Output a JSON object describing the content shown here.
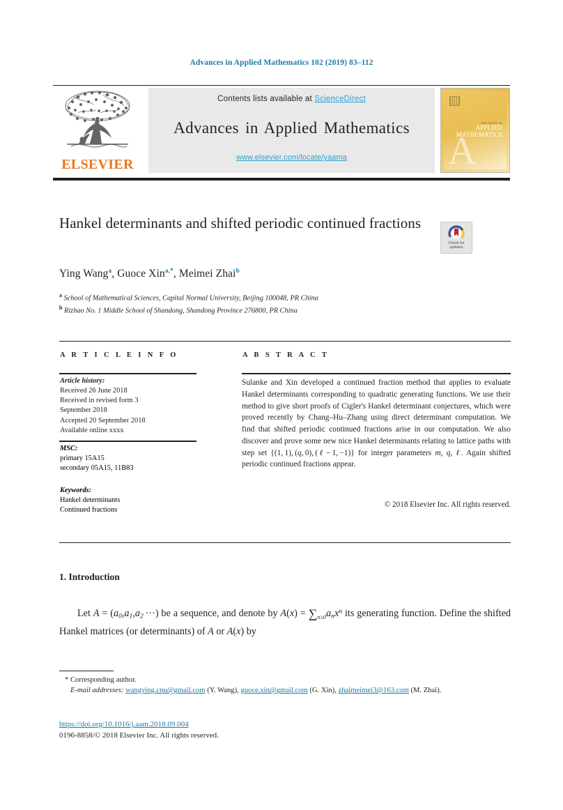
{
  "running_head": "Advances in Applied Mathematics 102 (2019) 83–112",
  "masthead": {
    "contents_prefix": "Contents lists available at ",
    "sciencedirect": "ScienceDirect",
    "journal_title": "Advances in Applied Mathematics",
    "journal_url": "www.elsevier.com/locate/yaama",
    "publisher_wordmark": "ELSEVIER",
    "cover": {
      "line_small": "ADVANCES IN",
      "line_1": "APPLIED",
      "line_2": "MATHEMATICS",
      "big_letter": "A"
    },
    "colors": {
      "link": "#2d9fd0",
      "rule": "#231f20",
      "box_bg": "#e9e9e9",
      "elsevier_orange": "#e87722",
      "cover_gold": "#eec664"
    }
  },
  "article": {
    "title": "Hankel determinants and shifted periodic continued fractions",
    "crossmark": {
      "line1": "Check for",
      "line2": "updates"
    },
    "authors_html": "Ying Wang<sup class=\"aff-mark\">a</sup>, Guoce Xin<sup class=\"aff-mark\">a,*</sup>, Meimei Zhai<sup class=\"aff-mark\">b</sup>",
    "affiliation_a": "School of Mathematical Sciences, Capital Normal University, Beijing 100048, PR China",
    "affiliation_b": "Rizhao No. 1 Middle School of Shandong, Shandong Province 276800, PR China"
  },
  "info_column": {
    "heading": "A R T I C L E   I N F O",
    "history_label": "Article history:",
    "history_lines": [
      "Received 26 June 2018",
      "Received in revised form 3",
      "September 2018",
      "Accepted 20 September 2018",
      "Available online xxxx"
    ],
    "msc_label": "MSC:",
    "msc_lines": [
      "primary 15A15",
      "secondary 05A15, 11B83"
    ],
    "keywords_label": "Keywords:",
    "keywords": [
      "Hankel determinants",
      "Continued fractions"
    ]
  },
  "abstract_column": {
    "heading": "A B S T R A C T",
    "text_html": "Sulanke and Xin developed a continued fraction method that applies to evaluate Hankel determinants corresponding to quadratic generating functions. We use their method to give short proofs of Cigler's Hankel determinant conjectures, which were proved recently by Chang–Hu–Zhang using direct determinant computation. We find that shifted periodic continued fractions arise in our computation. We also discover and prove some new nice Hankel determinants relating to lattice paths with step set {(1,&#8201;1),&#8201;(<span class=\"mathit\">q</span>,&#8201;0),&#8201;(<span class=\"mathit\">&#8467;</span>&#8201;&#8722;&#8201;1,&#8201;&#8722;1)} for integer parameters <span class=\"mathit\">m</span>, <span class=\"mathit\">q</span>, <span class=\"mathit\">&#8467;</span>. Again shifted periodic continued fractions appear.",
    "copyright": "© 2018 Elsevier Inc. All rights reserved."
  },
  "body": {
    "section_number_title": "1. Introduction",
    "paragraph_html": "<span class=\"ind\"></span>Let <span class=\"mi\">A</span> = (<span class=\"mi\">a</span><span class=\"sub\">0</span>,<span class=\"mi\">a</span><span class=\"sub\">1</span>,<span class=\"mi\">a</span><span class=\"sub\">2</span>&#8201;&#183;&#183;&#183;) be a sequence, and denote by <span class=\"mi\">A</span>(<span class=\"mi\">x</span>) = <span class=\"bigsum\">&#8721;</span><span class=\"sumlim\">n&#8805;0</span><span class=\"mi\">a</span><span class=\"sub\">n</span><span class=\"mi\">x</span><span class=\"sup\">n</span> its generating function. Define the shifted Hankel matrices (or determinants) of <span class=\"mi\">A</span> or <span class=\"mi\">A</span>(<span class=\"mi\">x</span>) by"
  },
  "footer": {
    "corresponding_author": "Corresponding author.",
    "email_label": "E-mail addresses:",
    "emails": [
      {
        "address": "wangying.cnu@gmail.com",
        "owner": "(Y. Wang)"
      },
      {
        "address": "guoce.xin@gmail.com",
        "owner": "(G. Xin)"
      },
      {
        "address": "zhaimeimei3@163.com",
        "owner": "(M. Zhai)."
      }
    ],
    "doi": "https://doi.org/10.1016/j.aam.2018.09.004",
    "issn_line": "0196-8858/© 2018 Elsevier Inc. All rights reserved."
  }
}
